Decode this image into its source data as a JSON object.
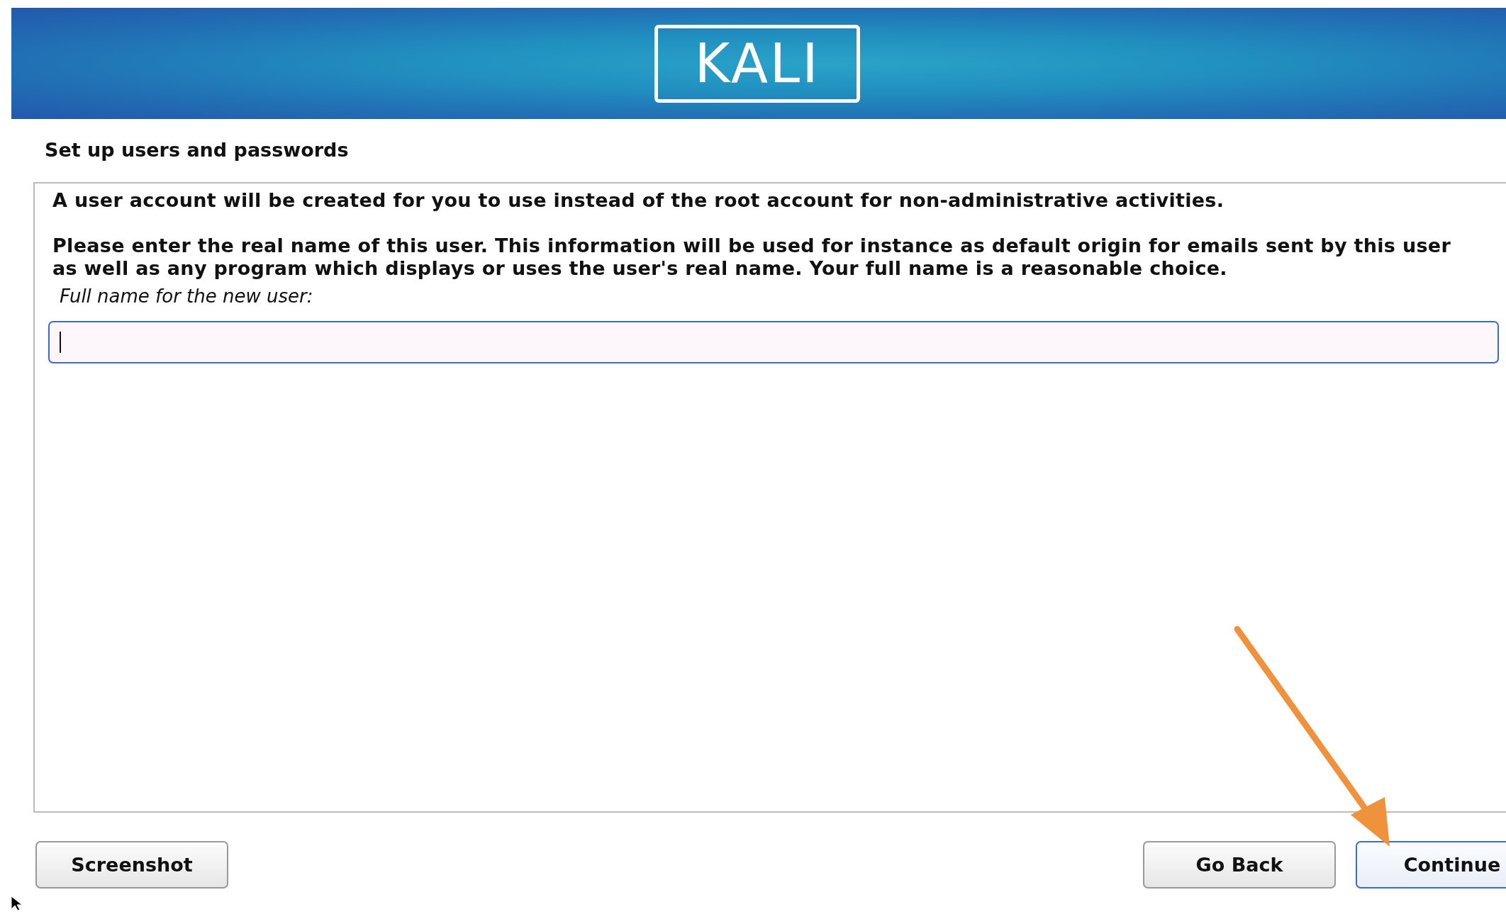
{
  "header": {
    "logo": "KALI"
  },
  "title": "Set up users and passwords",
  "dialog": {
    "paragraphs": [
      "A user account will be created for you to use instead of the root account for non-administrative activities.",
      "Please enter the real name of this user. This information will be used for instance as default origin for emails sent by this user as well as any program which displays or uses the user's real name. Your full name is a reasonable choice."
    ],
    "field": {
      "label": "Full name for the new user:",
      "focused": true
    }
  },
  "buttons": [
    {
      "label": "Screenshot",
      "focused": false
    },
    {
      "label": "Go Back",
      "focused": false
    },
    {
      "label": "Continue",
      "focused": true
    }
  ]
}
